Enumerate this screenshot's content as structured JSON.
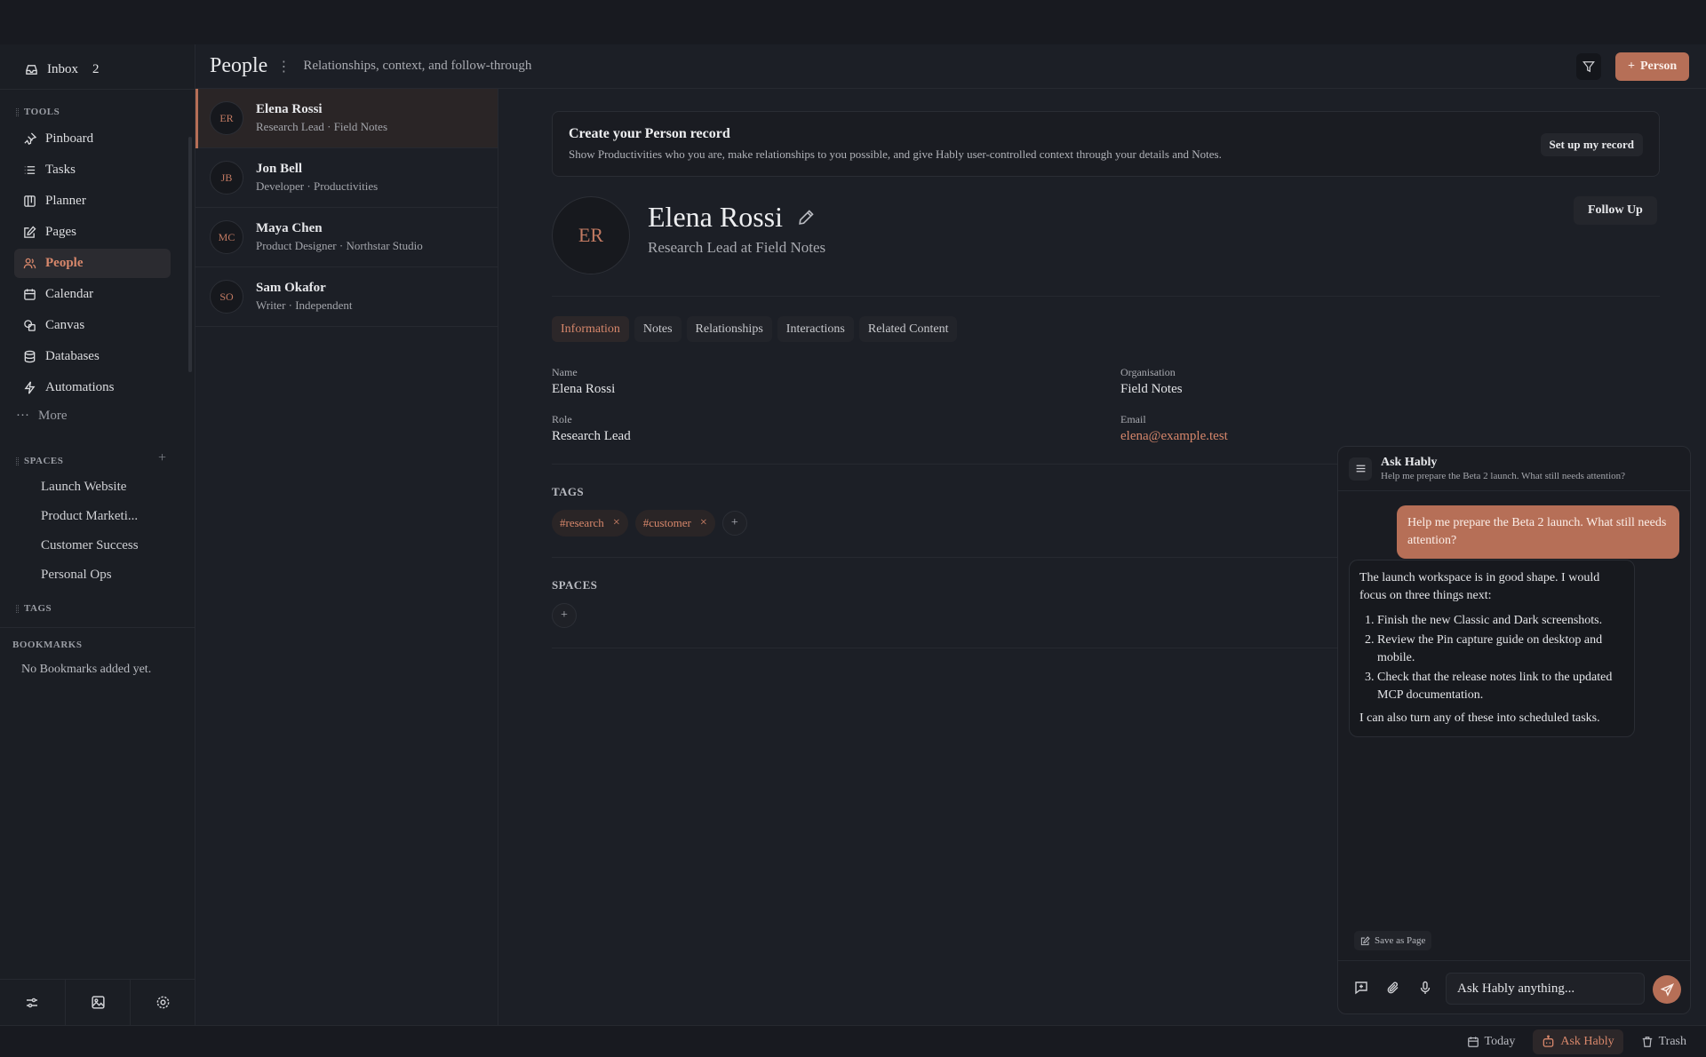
{
  "colors": {
    "accent": "#b66f57",
    "accent_text": "#d7876b",
    "background": "#1c1f26"
  },
  "sidebar": {
    "inbox_label": "Inbox",
    "inbox_count": "2",
    "tools_heading": "TOOLS",
    "items": [
      {
        "label": "Pinboard",
        "icon": "pin-icon"
      },
      {
        "label": "Tasks",
        "icon": "list-icon"
      },
      {
        "label": "Planner",
        "icon": "kanban-icon"
      },
      {
        "label": "Pages",
        "icon": "edit-page-icon"
      },
      {
        "label": "People",
        "icon": "people-icon"
      },
      {
        "label": "Calendar",
        "icon": "calendar-icon"
      },
      {
        "label": "Canvas",
        "icon": "canvas-icon"
      },
      {
        "label": "Databases",
        "icon": "database-icon"
      },
      {
        "label": "Automations",
        "icon": "bolt-icon"
      }
    ],
    "more_label": "More",
    "spaces_heading": "SPACES",
    "spaces": [
      "Launch Website",
      "Product Marketi...",
      "Customer Success",
      "Personal Ops"
    ],
    "tags_heading": "TAGS",
    "bookmarks_heading": "BOOKMARKS",
    "bookmarks_empty": "No Bookmarks added yet."
  },
  "header": {
    "title": "People",
    "subtitle": "Relationships, context, and follow-through",
    "add_button": "Person"
  },
  "people": [
    {
      "initials": "ER",
      "name": "Elena Rossi",
      "sub": "Research Lead · Field Notes"
    },
    {
      "initials": "JB",
      "name": "Jon Bell",
      "sub": "Developer · Productivities"
    },
    {
      "initials": "MC",
      "name": "Maya Chen",
      "sub": "Product Designer · Northstar Studio"
    },
    {
      "initials": "SO",
      "name": "Sam Okafor",
      "sub": "Writer · Independent"
    }
  ],
  "banner": {
    "title": "Create your Person record",
    "text": "Show Productivities who you are, make relationships to you possible, and give Hably user-controlled context through your details and Notes.",
    "button": "Set up my record"
  },
  "detail": {
    "initials": "ER",
    "name": "Elena Rossi",
    "role_line": "Research Lead at Field Notes",
    "follow_button": "Follow Up",
    "tabs": [
      "Information",
      "Notes",
      "Relationships",
      "Interactions",
      "Related Content"
    ],
    "fields": {
      "name_label": "Name",
      "name_value": "Elena Rossi",
      "org_label": "Organisation",
      "org_value": "Field Notes",
      "role_label": "Role",
      "role_value": "Research Lead",
      "email_label": "Email",
      "email_value": "elena@example.test"
    },
    "tags_heading": "TAGS",
    "tags": [
      "#research",
      "#customer"
    ],
    "spaces_heading": "SPACES"
  },
  "chat": {
    "title": "Ask Hably",
    "subtitle": "Help me prepare the Beta 2 launch. What still needs attention?",
    "user_message": "Help me prepare the Beta 2 launch. What still needs attention?",
    "bot_intro": "The launch workspace is in good shape. I would focus on three things next:",
    "bot_items": [
      "Finish the new Classic and Dark screenshots.",
      "Review the Pin capture guide on desktop and mobile.",
      "Check that the release notes link to the updated MCP documentation."
    ],
    "bot_outro": "I can also turn any of these into scheduled tasks.",
    "save_page": "Save as Page",
    "input_placeholder": "Ask Hably anything..."
  },
  "statusbar": {
    "today": "Today",
    "ask": "Ask Hably",
    "trash": "Trash"
  }
}
